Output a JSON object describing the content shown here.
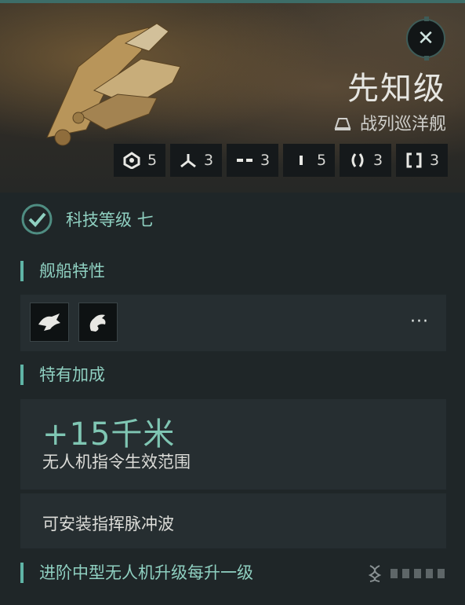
{
  "ship": {
    "name": "先知级",
    "class_label": "战列巡洋舰",
    "class_icon": "hull-class-icon"
  },
  "close_button": {
    "icon": "close-icon",
    "label": "✕"
  },
  "slots": [
    {
      "icon": "high-slot-icon",
      "value": "5"
    },
    {
      "icon": "drone-slot-icon",
      "value": "3"
    },
    {
      "icon": "mid-slot-icon",
      "value": "3"
    },
    {
      "icon": "low-slot-icon",
      "value": "5"
    },
    {
      "icon": "rig-slot-icon",
      "value": "3"
    },
    {
      "icon": "subsystem-slot-icon",
      "value": "3"
    }
  ],
  "tech": {
    "label": "科技等级 七"
  },
  "traits": {
    "title": "舰船特性",
    "icons": [
      "trait-mount-icon",
      "trait-dragon-icon"
    ],
    "more_label": "···"
  },
  "special_bonus": {
    "title": "特有加成",
    "items": [
      {
        "value": "+15千米",
        "description": "无人机指令生效范围"
      },
      {
        "text": "可安装指挥脉冲波"
      }
    ]
  },
  "skill_section": {
    "title": "进阶中型无人机升级每升一级",
    "progress_total": 5,
    "progress_filled": 0
  },
  "colors": {
    "accent": "#8fd0c1",
    "panel": "#262e31",
    "background": "#1f2628"
  }
}
